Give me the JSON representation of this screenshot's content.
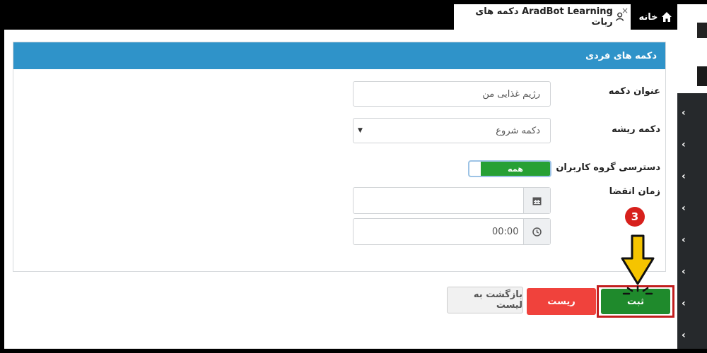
{
  "tabs": {
    "active_label": "AradBot Learning دکمه های ربات",
    "close_symbol": "×",
    "home_label": "خانه"
  },
  "panel": {
    "title": "دکمه های فردی"
  },
  "form": {
    "button_title_label": "عنوان دکمه",
    "button_title_value": "رژیم غذایی من",
    "root_button_label": "دکمه ریشه",
    "root_button_value": "دکمه شروع",
    "group_access_label": "دسترسی گروه کاربران",
    "group_access_value": "همه",
    "expiry_label": "زمان انقضا",
    "date_value": "",
    "time_value": "00:00"
  },
  "actions": {
    "back_label": "بازگشت به لیست",
    "reset_label": "ریست",
    "save_label": "ثبت"
  },
  "annotation": {
    "step_number": "3"
  },
  "sidebar": {
    "chevron_symbol": "‹"
  },
  "colors": {
    "header_blue": "#2f93c9",
    "save_green": "#1f8a2c",
    "reset_red": "#f0423c",
    "highlight_red": "#c21e1e",
    "arrow_yellow": "#f5c400"
  }
}
